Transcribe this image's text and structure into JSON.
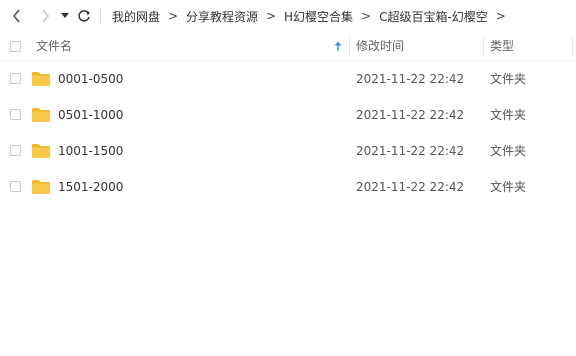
{
  "nav": {
    "back_icon": "chevron-left-icon",
    "forward_icon": "chevron-right-icon",
    "history_icon": "dropdown-caret-icon",
    "refresh_icon": "refresh-icon",
    "breadcrumb": [
      "我的网盘",
      "分享教程资源",
      "H幻樱空合集",
      "C超级百宝箱-幻樱空"
    ],
    "separator": ">"
  },
  "columns": {
    "name": "文件名",
    "modified": "修改时间",
    "type": "类型",
    "sort_icon": "sort-up-arrow-icon"
  },
  "files": [
    {
      "name": "0001-0500",
      "modified": "2021-11-22 22:42",
      "type": "文件夹",
      "icon": "folder-icon"
    },
    {
      "name": "0501-1000",
      "modified": "2021-11-22 22:42",
      "type": "文件夹",
      "icon": "folder-icon"
    },
    {
      "name": "1001-1500",
      "modified": "2021-11-22 22:42",
      "type": "文件夹",
      "icon": "folder-icon"
    },
    {
      "name": "1501-2000",
      "modified": "2021-11-22 22:42",
      "type": "文件夹",
      "icon": "folder-icon"
    }
  ],
  "colors": {
    "folder": "#f7c84a",
    "folder_tab": "#f0b930",
    "sort_arrow": "#3a8ee6"
  }
}
